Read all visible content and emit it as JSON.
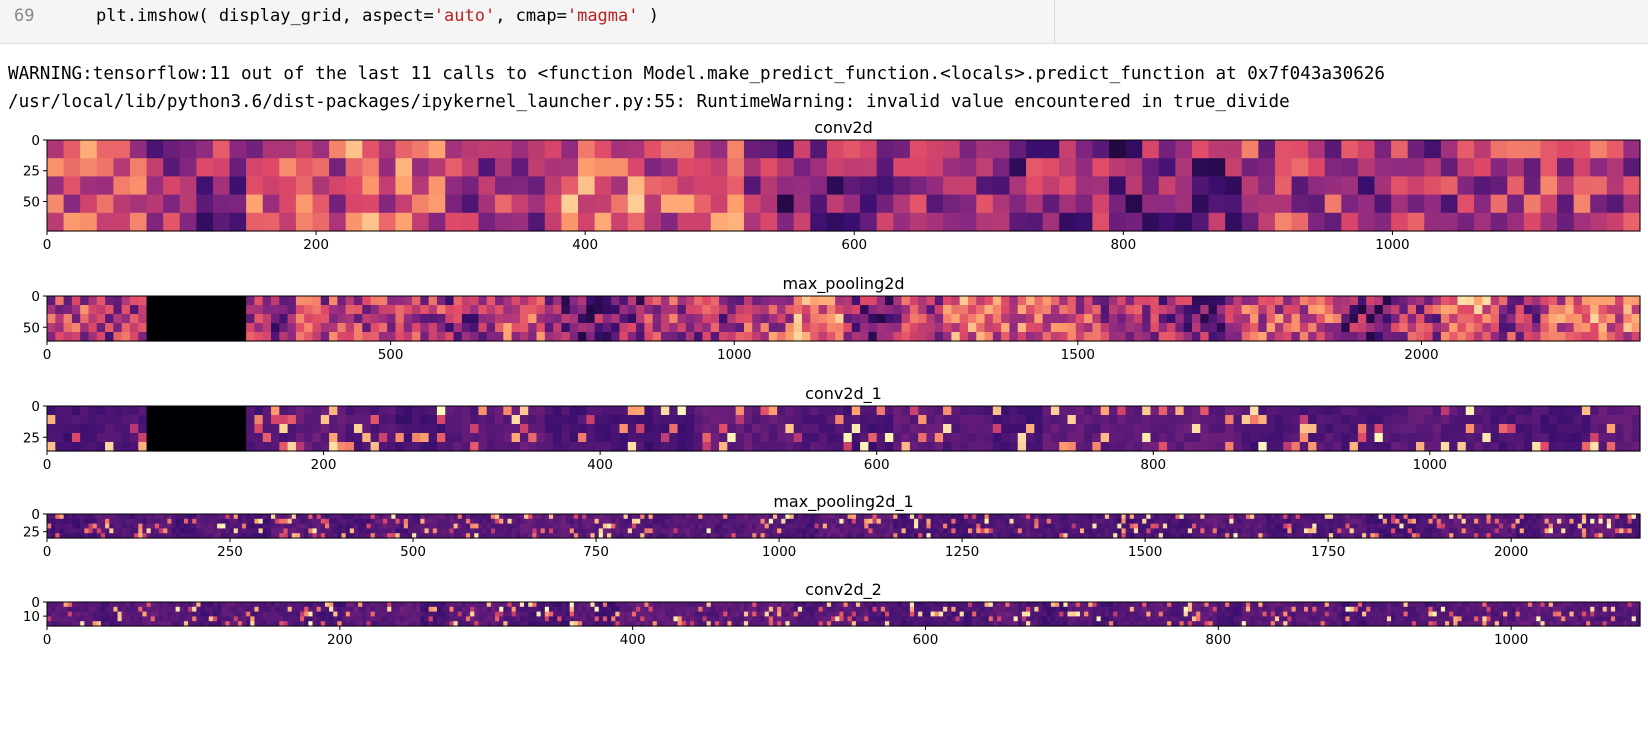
{
  "code_cell": {
    "line_number": "69",
    "code_prefix": "plt.imshow( display_grid, aspect=",
    "arg_aspect": "'auto'",
    "code_mid": ", cmap=",
    "arg_cmap": "'magma'",
    "code_suffix": " )"
  },
  "output": {
    "warning_line": "WARNING:tensorflow:11 out of the last 11 calls to <function Model.make_predict_function.<locals>.predict_function at 0x7f043a30626",
    "runtime_warning_line": "/usr/local/lib/python3.6/dist-packages/ipykernel_launcher.py:55: RuntimeWarning: invalid value encountered in true_divide"
  },
  "colormap": [
    "#000004",
    "#3b0f70",
    "#8c2981",
    "#de4968",
    "#fe9f6d",
    "#fcfdbf"
  ],
  "chart_data": [
    {
      "type": "heatmap",
      "title": "conv2d",
      "xticks": [
        "0",
        "200",
        "400",
        "600",
        "800",
        "1000"
      ],
      "xtick_values": [
        0,
        200,
        400,
        600,
        800,
        1000
      ],
      "xlim": [
        0,
        1184
      ],
      "yticks": [
        "0",
        "25",
        "50"
      ],
      "ytick_values": [
        0,
        25,
        50
      ],
      "ylim": [
        0,
        74
      ],
      "channels": 16
    },
    {
      "type": "heatmap",
      "title": "max_pooling2d",
      "xticks": [
        "0",
        "500",
        "1000",
        "1500",
        "2000"
      ],
      "xtick_values": [
        0,
        500,
        1000,
        1500,
        2000
      ],
      "xlim": [
        0,
        2318
      ],
      "yticks": [
        "0",
        "50"
      ],
      "ytick_values": [
        0,
        50
      ],
      "ylim": [
        0,
        72
      ],
      "channels": 32
    },
    {
      "type": "heatmap",
      "title": "conv2d_1",
      "xticks": [
        "0",
        "200",
        "400",
        "600",
        "800",
        "1000"
      ],
      "xtick_values": [
        0,
        200,
        400,
        600,
        800,
        1000
      ],
      "xlim": [
        0,
        1152
      ],
      "yticks": [
        "0",
        "25"
      ],
      "ytick_values": [
        0,
        25
      ],
      "ylim": [
        0,
        36
      ],
      "channels": 32
    },
    {
      "type": "heatmap",
      "title": "max_pooling2d_1",
      "xticks": [
        "0",
        "250",
        "500",
        "750",
        "1000",
        "1250",
        "1500",
        "1750",
        "2000"
      ],
      "xtick_values": [
        0,
        250,
        500,
        750,
        1000,
        1250,
        1500,
        1750,
        2000
      ],
      "xlim": [
        0,
        2176
      ],
      "yticks": [
        "0",
        "25"
      ],
      "ytick_values": [
        0,
        25
      ],
      "ylim": [
        0,
        34
      ],
      "channels": 64
    },
    {
      "type": "heatmap",
      "title": "conv2d_2",
      "xticks": [
        "0",
        "200",
        "400",
        "600",
        "800",
        "1000"
      ],
      "xtick_values": [
        0,
        200,
        400,
        600,
        800,
        1000
      ],
      "xlim": [
        0,
        1088
      ],
      "yticks": [
        "0",
        "10"
      ],
      "ytick_values": [
        0,
        10
      ],
      "ylim": [
        0,
        17
      ],
      "channels": 64
    }
  ]
}
